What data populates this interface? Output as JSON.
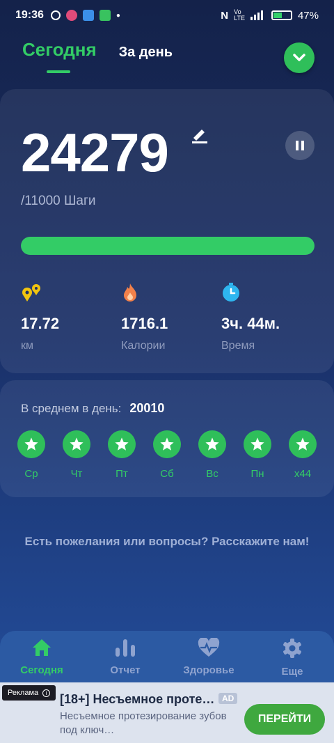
{
  "status_bar": {
    "time": "19:36",
    "battery": "47%",
    "battery_level": 0.47
  },
  "tabs": [
    {
      "label": "Сегодня",
      "active": true
    },
    {
      "label": "За день",
      "active": false
    }
  ],
  "main": {
    "steps": "24279",
    "goal": "/11000 Шаги",
    "progress_fraction": 1.0,
    "stats": [
      {
        "icon": "distance-icon",
        "value": "17.72",
        "label": "км"
      },
      {
        "icon": "fire-icon",
        "value": "1716.1",
        "label": "Калории"
      },
      {
        "icon": "timer-icon",
        "value": "3ч. 44м.",
        "label": "Время"
      }
    ]
  },
  "average": {
    "label": "В среднем в день:",
    "value": "20010",
    "days": [
      "Ср",
      "Чт",
      "Пт",
      "Сб",
      "Вс",
      "Пн",
      "x44"
    ]
  },
  "feedback": {
    "text": "Есть пожелания или вопросы? Расскажите нам!"
  },
  "bottom_nav": [
    {
      "label": "Сегодня",
      "icon": "home-icon",
      "active": true
    },
    {
      "label": "Отчет",
      "icon": "chart-icon",
      "active": false
    },
    {
      "label": "Здоровье",
      "icon": "heart-pulse-icon",
      "active": false
    },
    {
      "label": "Еще",
      "icon": "gear-icon",
      "active": false
    }
  ],
  "ad": {
    "tag": "Реклама",
    "title": "[18+] Несъемное проте…",
    "badge": "AD",
    "description": "Несъемное протезирование зубов под ключ…",
    "button": "ПЕРЕЙТИ"
  },
  "colors": {
    "accent": "#33cc66",
    "background": "#1a3068"
  }
}
